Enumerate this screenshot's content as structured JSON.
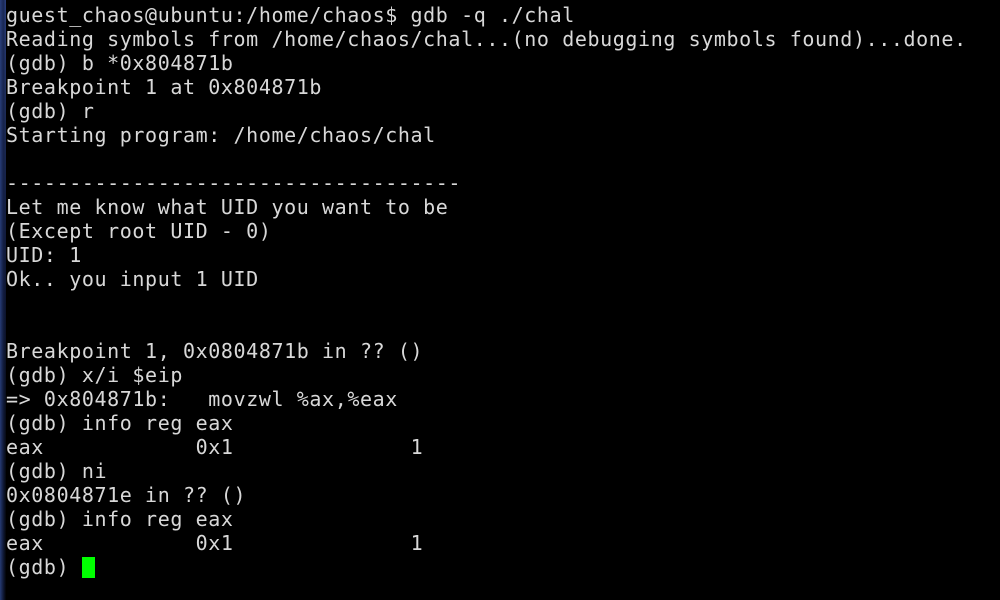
{
  "terminal": {
    "title": "gdb -q ./chal",
    "background_color": "#000000",
    "text_color": "#d8d8d8",
    "cursor_color": "#00ff00",
    "edge_stripe_color": "#2b4080",
    "shell_user_host": "guest_chaos@ubuntu",
    "shell_cwd": "/home/chaos",
    "prompt_symbol": "$",
    "gdb_prompt": "(gdb) ",
    "cursor_icon": "block-cursor",
    "lines": [
      {
        "id": "line-shell-command",
        "text": "guest_chaos@ubuntu:/home/chaos$ gdb -q ./chal"
      },
      {
        "id": "line-reading-symbols",
        "text": "Reading symbols from /home/chaos/chal...(no debugging symbols found)...done."
      },
      {
        "id": "line-cmd-break",
        "text": "(gdb) b *0x804871b"
      },
      {
        "id": "line-breakpoint-set",
        "text": "Breakpoint 1 at 0x804871b"
      },
      {
        "id": "line-cmd-run",
        "text": "(gdb) r"
      },
      {
        "id": "line-starting-program",
        "text": "Starting program: /home/chaos/chal"
      },
      {
        "id": "line-blank-1",
        "text": ""
      },
      {
        "id": "line-separator",
        "text": "------------------------------------"
      },
      {
        "id": "line-prompt-uid-question",
        "text": "Let me know what UID you want to be"
      },
      {
        "id": "line-prompt-uid-except",
        "text": "(Except root UID - 0)"
      },
      {
        "id": "line-uid-input",
        "text": "UID: 1"
      },
      {
        "id": "line-uid-confirm",
        "text": "Ok.. you input 1 UID"
      },
      {
        "id": "line-blank-2",
        "text": ""
      },
      {
        "id": "line-blank-3",
        "text": ""
      },
      {
        "id": "line-breakpoint-hit",
        "text": "Breakpoint 1, 0x0804871b in ?? ()"
      },
      {
        "id": "line-cmd-xi-eip",
        "text": "(gdb) x/i $eip"
      },
      {
        "id": "line-disasm-movzwl",
        "text": "=> 0x804871b:\tmovzwl %ax,%eax"
      },
      {
        "id": "line-cmd-info-reg-1",
        "text": "(gdb) info reg eax"
      },
      {
        "id": "line-reg-eax-1",
        "text": "eax            0x1\t1"
      },
      {
        "id": "line-cmd-ni",
        "text": "(gdb) ni"
      },
      {
        "id": "line-after-ni",
        "text": "0x0804871e in ?? ()"
      },
      {
        "id": "line-cmd-info-reg-2",
        "text": "(gdb) info reg eax"
      },
      {
        "id": "line-reg-eax-2",
        "text": "eax            0x1\t1"
      }
    ],
    "active_prompt": "(gdb) ",
    "registers": [
      {
        "name": "eax",
        "hex": "0x1",
        "dec": "1"
      }
    ],
    "breakpoints": [
      {
        "number": "1",
        "address": "0x804871b",
        "hit_address": "0x0804871b"
      }
    ],
    "disassembly": [
      {
        "marker": "=>",
        "address": "0x804871b:",
        "mnemonic": "movzwl",
        "operands": "%ax,%eax"
      }
    ]
  }
}
